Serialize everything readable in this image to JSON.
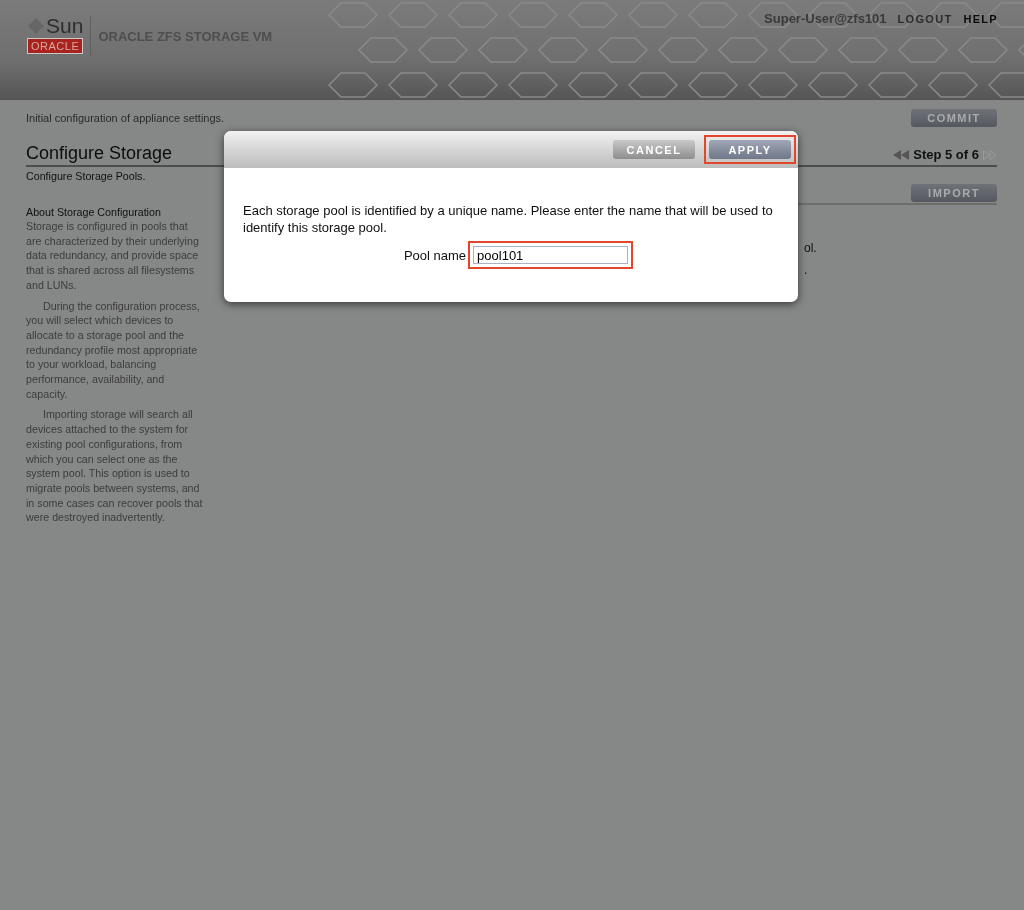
{
  "header": {
    "brand_top": "Sun",
    "brand_badge": "ORACLE",
    "product": "ORACLE ZFS STORAGE VM",
    "user": "Super-User@zfs101",
    "links": [
      "LOGOUT",
      "HELP"
    ]
  },
  "page": {
    "subtitle": "Initial configuration of appliance settings.",
    "commit_button": "COMMIT",
    "title": "Configure Storage",
    "step": "Step 5 of 6",
    "description": "Configure Storage Pools.",
    "import_button": "IMPORT",
    "behind_text": [
      "ol.",
      "."
    ]
  },
  "sidebar": {
    "heading": "About Storage Configuration",
    "paragraphs": [
      "Storage is configured in pools that are characterized by their underlying data redundancy, and provide space that is shared across all filesystems and LUNs.",
      "During the configuration process, you will select which devices to allocate to a storage pool and the redundancy profile most appropriate to your workload, balancing performance, availability, and capacity.",
      "Importing storage will search all devices attached to the system for existing pool configurations, from which you can select one as the system pool. This option is used to migrate pools between systems, and in some cases can recover pools that were destroyed inadvertently."
    ]
  },
  "dialog": {
    "buttons": [
      {
        "label": "CANCEL",
        "kind": "secondary",
        "highlighted": false
      },
      {
        "label": "APPLY",
        "kind": "primary",
        "highlighted": true
      }
    ],
    "message": "Each storage pool is identified by a unique name. Please enter the name that will be used to identify this storage pool.",
    "field": {
      "label": "Pool name",
      "value": "pool101",
      "highlighted": true
    }
  }
}
